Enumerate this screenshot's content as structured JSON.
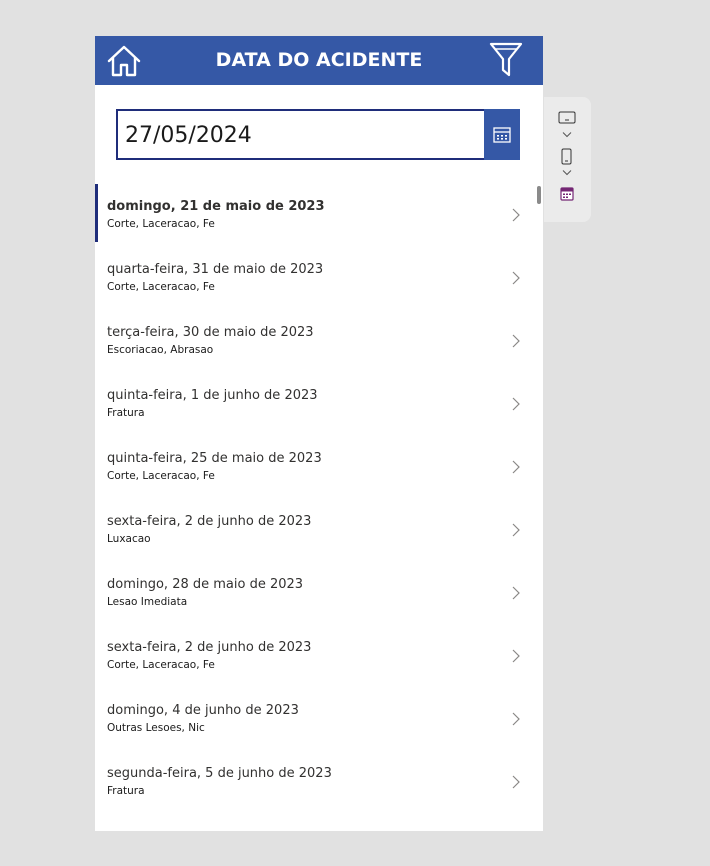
{
  "header": {
    "title": "DATA DO ACIDENTE",
    "home_icon": "home-icon",
    "filter_icon": "filter-icon",
    "color": "#3558a6"
  },
  "date_picker": {
    "value": "27/05/2024",
    "calendar_icon": "calendar-icon"
  },
  "list": {
    "items": [
      {
        "date": "domingo, 21 de maio de 2023",
        "type": "Corte, Laceracao, Fe",
        "selected": true
      },
      {
        "date": "quarta-feira, 31 de maio de 2023",
        "type": "Corte, Laceracao, Fe"
      },
      {
        "date": "terça-feira, 30 de maio de 2023",
        "type": "Escoriacao, Abrasao"
      },
      {
        "date": "quinta-feira, 1 de junho de 2023",
        "type": "Fratura"
      },
      {
        "date": "quinta-feira, 25 de maio de 2023",
        "type": "Corte, Laceracao, Fe"
      },
      {
        "date": "sexta-feira, 2 de junho de 2023",
        "type": "Luxacao"
      },
      {
        "date": "domingo, 28 de maio de 2023",
        "type": "Lesao Imediata"
      },
      {
        "date": "sexta-feira, 2 de junho de 2023",
        "type": "Corte, Laceracao, Fe"
      },
      {
        "date": "domingo, 4 de junho de 2023",
        "type": "Outras Lesoes, Nic"
      },
      {
        "date": "segunda-feira, 5 de junho de 2023",
        "type": "Fratura"
      }
    ]
  },
  "side_panel": {
    "icons": [
      "tablet-landscape-icon",
      "chevron-down-icon",
      "phone-portrait-icon",
      "chevron-down-icon",
      "calendar-app-icon"
    ]
  },
  "colors": {
    "accent": "#3558a6",
    "border": "#1f2d7a",
    "background": "#e1e1e1"
  }
}
